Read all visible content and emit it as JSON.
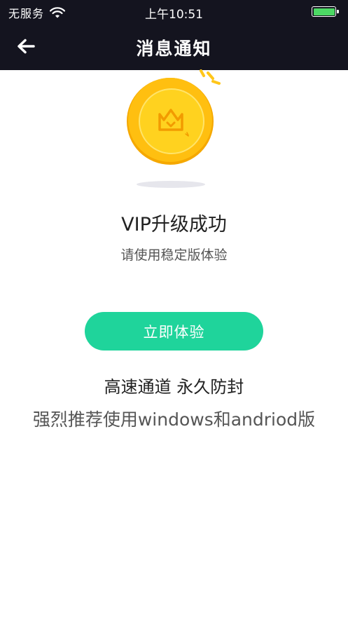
{
  "status_bar": {
    "carrier": "无服务",
    "time": "上午10:51",
    "wifi_icon": "wifi-icon",
    "battery_icon": "battery-icon"
  },
  "nav": {
    "back_icon": "arrow-left-icon",
    "title": "消息通知"
  },
  "hero": {
    "icon": "gold-coin-crown-icon"
  },
  "content": {
    "title": "VIP升级成功",
    "subtitle": "请使用稳定版体验",
    "cta_label": "立即体验",
    "feature_text": "高速通道 永久防封",
    "recommend_text": "强烈推荐使用windows和andriod版"
  },
  "colors": {
    "topbar": "#14141f",
    "accent": "#1fd49b",
    "coin_outer": "#f5a800",
    "coin_inner": "#ffd21f",
    "battery": "#4cd964"
  }
}
